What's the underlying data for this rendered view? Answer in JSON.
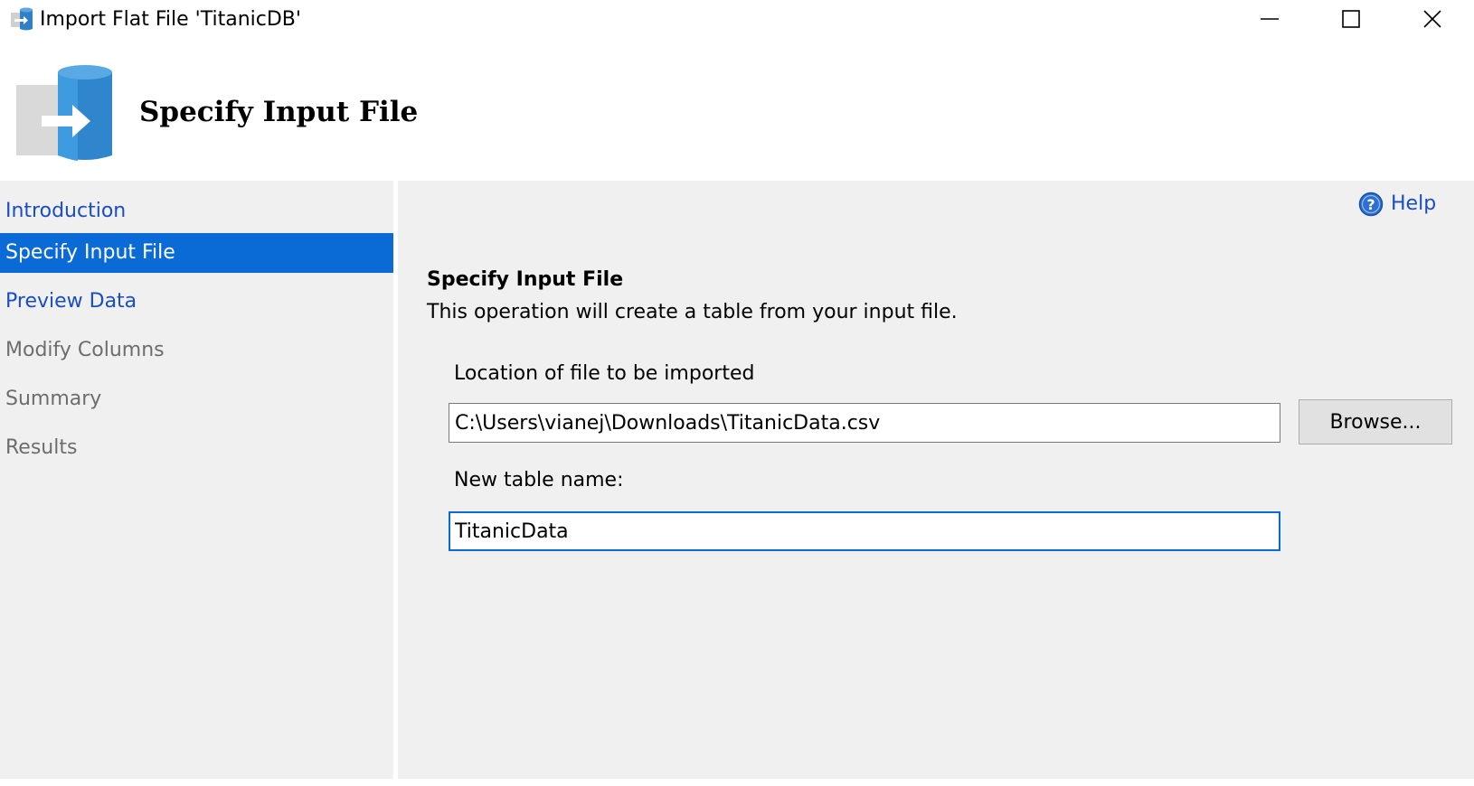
{
  "window": {
    "title": "Import Flat File 'TitanicDB'"
  },
  "header": {
    "title": "Specify Input File"
  },
  "sidebar": {
    "items": [
      {
        "label": "Introduction",
        "state": "link"
      },
      {
        "label": "Specify Input File",
        "state": "active"
      },
      {
        "label": "Preview Data",
        "state": "link"
      },
      {
        "label": "Modify Columns",
        "state": "disabled"
      },
      {
        "label": "Summary",
        "state": "disabled"
      },
      {
        "label": "Results",
        "state": "disabled"
      }
    ]
  },
  "main": {
    "help_label": "Help",
    "section_title": "Specify Input File",
    "section_description": "This operation will create a table from your input file.",
    "location_label": "Location of file to be imported",
    "location_value": "C:\\Users\\vianej\\Downloads\\TitanicData.csv",
    "browse_label": "Browse...",
    "table_name_label": "New table name:",
    "table_name_value": "TitanicData"
  },
  "colors": {
    "accent": "#0a6bd6",
    "link": "#1a4dc4",
    "disabled": "#6d6d6d",
    "panel": "#f0f0f0"
  },
  "icons": {
    "app": "import-flat-file-icon",
    "header": "database-import-icon",
    "help": "help-question-icon"
  }
}
